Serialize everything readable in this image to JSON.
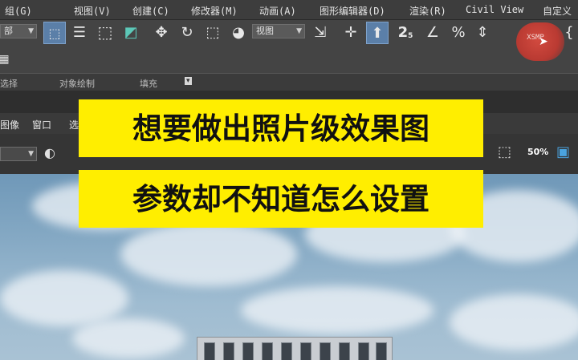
{
  "menu": {
    "items": [
      "组(G)",
      "视图(V)",
      "创建(C)",
      "修改器(M)",
      "动画(A)",
      "图形编辑器(D)",
      "渲染(R)",
      "Civil View",
      "自定义"
    ]
  },
  "toolbar": {
    "selection_filter": "部",
    "view_dropdown": "视图",
    "percent_icon": "%",
    "xsmp_label": "XSMP",
    "number_label": "2",
    "number_sub": "5"
  },
  "ribbon": {
    "labels": [
      "选择",
      "对象绘制",
      "填充"
    ]
  },
  "viewport_menu": {
    "items": [
      "图像",
      "窗口",
      "选"
    ]
  },
  "viewport_toolbar": {
    "zoom_label": "50%"
  },
  "banner": {
    "line1": "想要做出照片级效果图",
    "line2": "参数却不知道怎么设置"
  },
  "colors": {
    "banner_bg": "#ffee00",
    "banner_text": "#111111",
    "accent_blue": "#4aa3df",
    "active_button": "#5b7fa8"
  }
}
